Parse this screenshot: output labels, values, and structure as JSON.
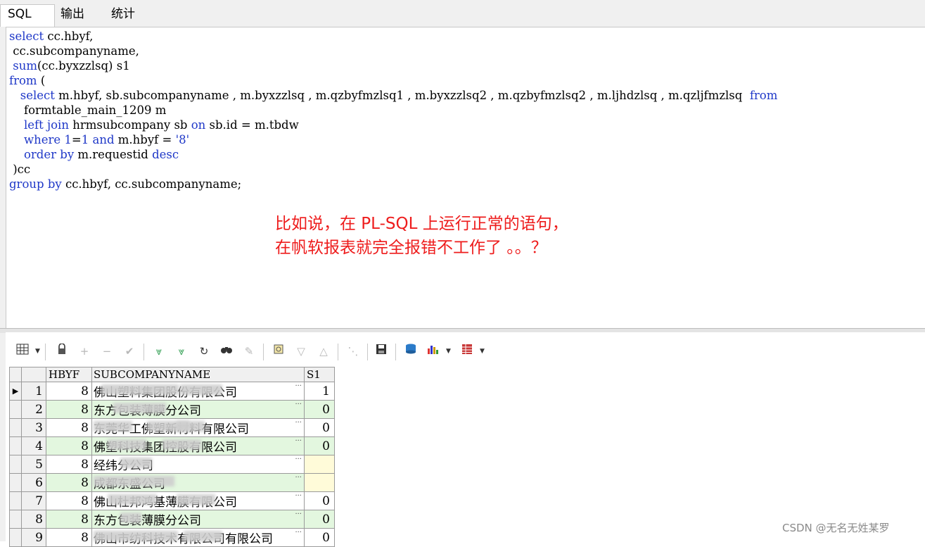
{
  "tabs": [
    "SQL",
    "输出",
    "统计"
  ],
  "sql_lines": [
    [
      {
        "t": "select",
        "k": 1
      },
      {
        "t": " cc.hbyf,"
      }
    ],
    [
      {
        "t": " cc.subcompanyname,"
      }
    ],
    [
      {
        "t": " "
      },
      {
        "t": "sum",
        "k": 1
      },
      {
        "t": "(cc.byxzzlsq) s1"
      }
    ],
    [
      {
        "t": "from",
        "k": 1
      },
      {
        "t": " ("
      }
    ],
    [
      {
        "t": "   "
      },
      {
        "t": "select",
        "k": 1
      },
      {
        "t": " m.hbyf, sb.subcompanyname , m.byxzzlsq , m.qzbyfmzlsq1 , m.byxzzlsq2 , m.qzbyfmzlsq2 , m.ljhdzlsq , m.qzljfmzlsq  "
      },
      {
        "t": "from",
        "k": 1
      }
    ],
    [
      {
        "t": "    formtable_main_1209 m"
      }
    ],
    [
      {
        "t": "    "
      },
      {
        "t": "left join",
        "k": 1
      },
      {
        "t": " hrmsubcompany sb "
      },
      {
        "t": "on",
        "k": 1
      },
      {
        "t": " sb.id = m.tbdw"
      }
    ],
    [
      {
        "t": "    "
      },
      {
        "t": "where",
        "k": 1
      },
      {
        "t": " "
      },
      {
        "t": "1",
        "k": 1
      },
      {
        "t": "="
      },
      {
        "t": "1",
        "k": 1
      },
      {
        "t": " "
      },
      {
        "t": "and",
        "k": 1
      },
      {
        "t": " m.hbyf = "
      },
      {
        "t": "'8'",
        "k": 1
      }
    ],
    [
      {
        "t": "    "
      },
      {
        "t": "order by",
        "k": 1
      },
      {
        "t": " m.requestid "
      },
      {
        "t": "desc",
        "k": 1
      }
    ],
    [
      {
        "t": " )cc"
      }
    ],
    [
      {
        "t": "group by",
        "k": 1
      },
      {
        "t": " cc.hbyf, cc.subcompanyname;"
      }
    ]
  ],
  "annotation": {
    "line1": "比如说，在 PL-SQL 上运行正常的语句，",
    "line2": "在帆软报表就完全报错不工作了 。。？"
  },
  "colors": {
    "keyword": "#1f38c8",
    "annotation": "#ee1c1c",
    "row_even": "#e3f7df",
    "empty_cell": "#fffbd9"
  },
  "toolbar_icons": [
    "grid-icon",
    "lock-icon",
    "add-row-icon",
    "delete-row-icon",
    "post-icon",
    "fetch-next-icon",
    "fetch-last-icon",
    "refresh-icon",
    "find-icon",
    "clear-icon",
    "query-by-example-icon",
    "previous-record-icon",
    "next-record-icon",
    "hierarchy-icon",
    "save-icon",
    "export-icon",
    "chart-icon",
    "table-view-icon"
  ],
  "grid": {
    "columns": [
      "HBYF",
      "SUBCOMPANYNAME",
      "S1"
    ],
    "rows": [
      {
        "n": "1",
        "hbyf": "8",
        "name": "佛山塑料集团股份有限公司",
        "s1": "1",
        "blur": [
          [
            13,
            110
          ],
          [
            125,
            60
          ]
        ]
      },
      {
        "n": "2",
        "hbyf": "8",
        "name": "东方包装薄膜分公司",
        "s1": "0",
        "blur": [
          [
            30,
            75
          ]
        ]
      },
      {
        "n": "3",
        "hbyf": "8",
        "name": "东莞华工佛塑新材料有限公司",
        "s1": "0",
        "blur": [
          [
            2,
            55
          ],
          [
            78,
            60
          ],
          [
            120,
            40
          ]
        ]
      },
      {
        "n": "4",
        "hbyf": "8",
        "name": "佛塑科技集团控股有限公司",
        "s1": "0",
        "blur": [
          [
            22,
            55
          ],
          [
            100,
            55
          ]
        ]
      },
      {
        "n": "5",
        "hbyf": "8",
        "name": "经纬分公司",
        "s1": "",
        "blur": [
          [
            40,
            45
          ]
        ]
      },
      {
        "n": "6",
        "hbyf": "8",
        "name": "成都东盛公司",
        "s1": "",
        "blur": [
          [
            2,
            115
          ]
        ]
      },
      {
        "n": "7",
        "hbyf": "8",
        "name": "佛山杜邦鸿基薄膜有限公司",
        "s1": "0",
        "blur": [
          [
            22,
            70
          ],
          [
            120,
            55
          ]
        ]
      },
      {
        "n": "8",
        "hbyf": "8",
        "name": "东方包装薄膜分公司",
        "s1": "0",
        "blur": [
          [
            40,
            30
          ]
        ]
      },
      {
        "n": "9",
        "hbyf": "8",
        "name": "佛山市纺科技术有限公司有限公司",
        "s1": "0",
        "blur": [
          [
            2,
            120
          ],
          [
            130,
            55
          ]
        ]
      }
    ]
  },
  "watermark": "CSDN @无名无姓某罗"
}
